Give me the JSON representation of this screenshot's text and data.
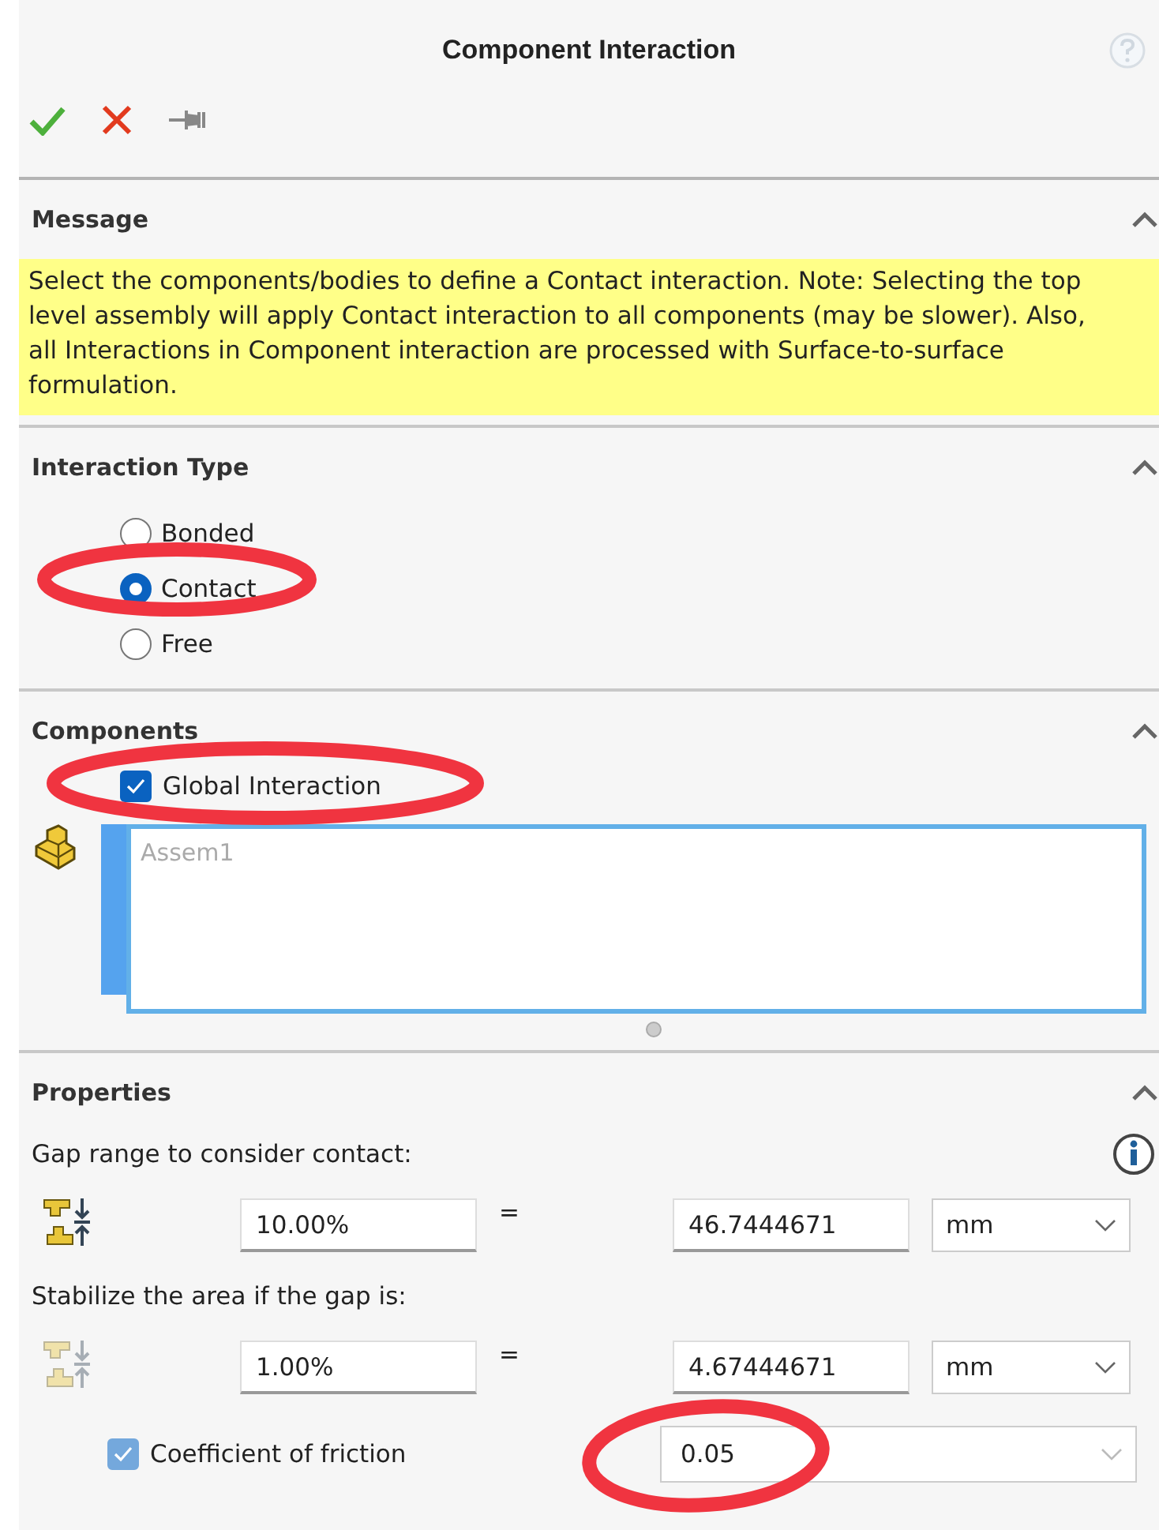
{
  "window": {
    "title": "Component Interaction"
  },
  "toolbar": [
    {
      "kind": "ok"
    },
    {
      "kind": "cancel"
    },
    {
      "kind": "pin"
    }
  ],
  "message": {
    "title": "Message",
    "expanded": true,
    "text": "Select the components/bodies to define a Contact interaction. Note: Selecting the top level assembly will apply Contact interaction to all components (may be slower). Also, all Interactions in Component interaction are processed with Surface-to-surface formulation."
  },
  "interaction_type": {
    "title": "Interaction Type",
    "expanded": true,
    "options": [
      {
        "label": "Bonded",
        "selected": false
      },
      {
        "label": "Contact",
        "selected": true
      },
      {
        "label": "Free",
        "selected": false
      }
    ]
  },
  "components": {
    "title": "Components",
    "expanded": true,
    "global_interaction": {
      "label": "Global Interaction",
      "checked": true
    },
    "list": {
      "items": [
        "Assem1"
      ]
    }
  },
  "properties": {
    "title": "Properties",
    "expanded": true,
    "rows": [
      {
        "label": "Gap range to consider contact:",
        "percent": "10.00%",
        "equals": "=",
        "value": "46.7444671",
        "unit": "mm",
        "disabled": false
      },
      {
        "label": "Stabilize the area if the gap is:",
        "percent": "1.00%",
        "equals": "=",
        "value": "4.67444671",
        "unit": "mm",
        "disabled": true
      }
    ],
    "friction": {
      "label": "Coefficient of friction",
      "checked": true,
      "value": "0.05"
    }
  },
  "annotations": [
    {
      "kind": "circle",
      "color": "#f03440"
    },
    {
      "kind": "circle",
      "color": "#f03440"
    },
    {
      "kind": "circle",
      "color": "#f03440"
    }
  ]
}
